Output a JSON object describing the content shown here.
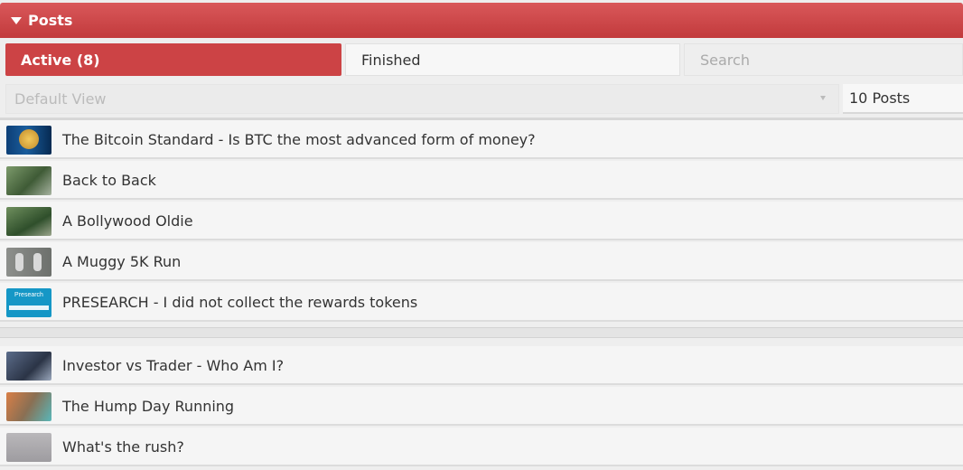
{
  "header": {
    "title": "Posts"
  },
  "tabs": {
    "active": "Active (8)",
    "finished": "Finished"
  },
  "search": {
    "placeholder": "Search"
  },
  "filters": {
    "view": "Default View",
    "count": "10 Posts"
  },
  "posts": [
    {
      "title": "The Bitcoin Standard - Is BTC the most advanced form of money?",
      "thumb": "bitcoin-thumbnail"
    },
    {
      "title": "Back to Back",
      "thumb": "street-thumbnail"
    },
    {
      "title": "A Bollywood Oldie",
      "thumb": "park-thumbnail"
    },
    {
      "title": "A Muggy 5K Run",
      "thumb": "shoes-thumbnail"
    },
    {
      "title": "PRESEARCH - I did not collect the rewards tokens",
      "thumb": "presearch-thumbnail",
      "thumb_text": "Presearch"
    },
    {
      "title": "Investor vs Trader - Who Am I?",
      "thumb": "laptop-thumbnail"
    },
    {
      "title": "The Hump Day Running",
      "thumb": "running-thumbnail"
    },
    {
      "title": "What's the rush?",
      "thumb": "sand-thumbnail"
    }
  ],
  "colors": {
    "accent": "#cc4345",
    "header": "#d04a4c"
  }
}
